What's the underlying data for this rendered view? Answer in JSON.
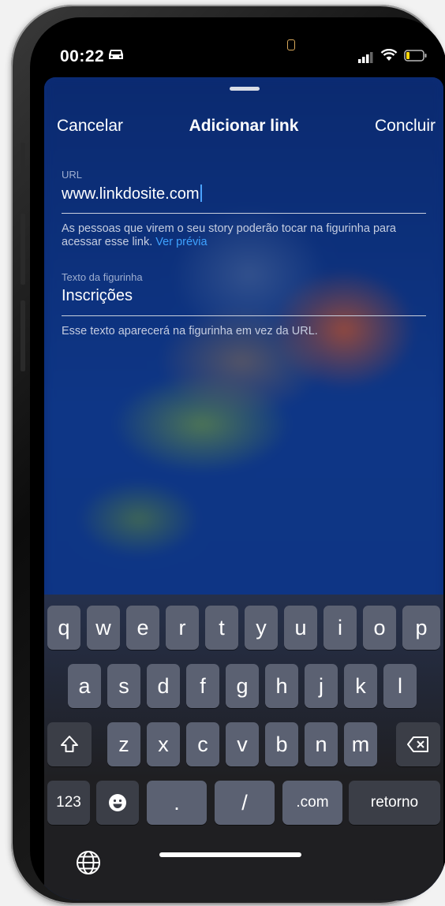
{
  "status_bar": {
    "time": "00:22"
  },
  "sheet": {
    "nav": {
      "cancel_label": "Cancelar",
      "title": "Adicionar link",
      "done_label": "Concluir"
    },
    "url": {
      "label": "URL",
      "value": "www.linkdosite.com",
      "help_text": "As pessoas que virem o seu story poderão tocar na figurinha para acessar esse link.",
      "preview_link": "Ver prévia"
    },
    "sticker_text": {
      "label": "Texto da figurinha",
      "value": "Inscrições",
      "help_text": "Esse texto aparecerá na figurinha em vez da URL."
    }
  },
  "keyboard": {
    "row1": [
      "q",
      "w",
      "e",
      "r",
      "t",
      "y",
      "u",
      "i",
      "o",
      "p"
    ],
    "row2": [
      "a",
      "s",
      "d",
      "f",
      "g",
      "h",
      "j",
      "k",
      "l"
    ],
    "row3": [
      "z",
      "x",
      "c",
      "v",
      "b",
      "n",
      "m"
    ],
    "numbers_key": "123",
    "dot_key": ".",
    "slash_key": "/",
    "com_key": ".com",
    "return_key": "retorno"
  },
  "colors": {
    "sheet_background": "#0c2d78",
    "link_accent": "#3ea2ff",
    "key_background": "#5b6172"
  },
  "icons": [
    "car-icon",
    "signal-icon",
    "wifi-icon",
    "battery-icon",
    "shift-icon",
    "backspace-icon",
    "emoji-icon",
    "globe-icon"
  ]
}
